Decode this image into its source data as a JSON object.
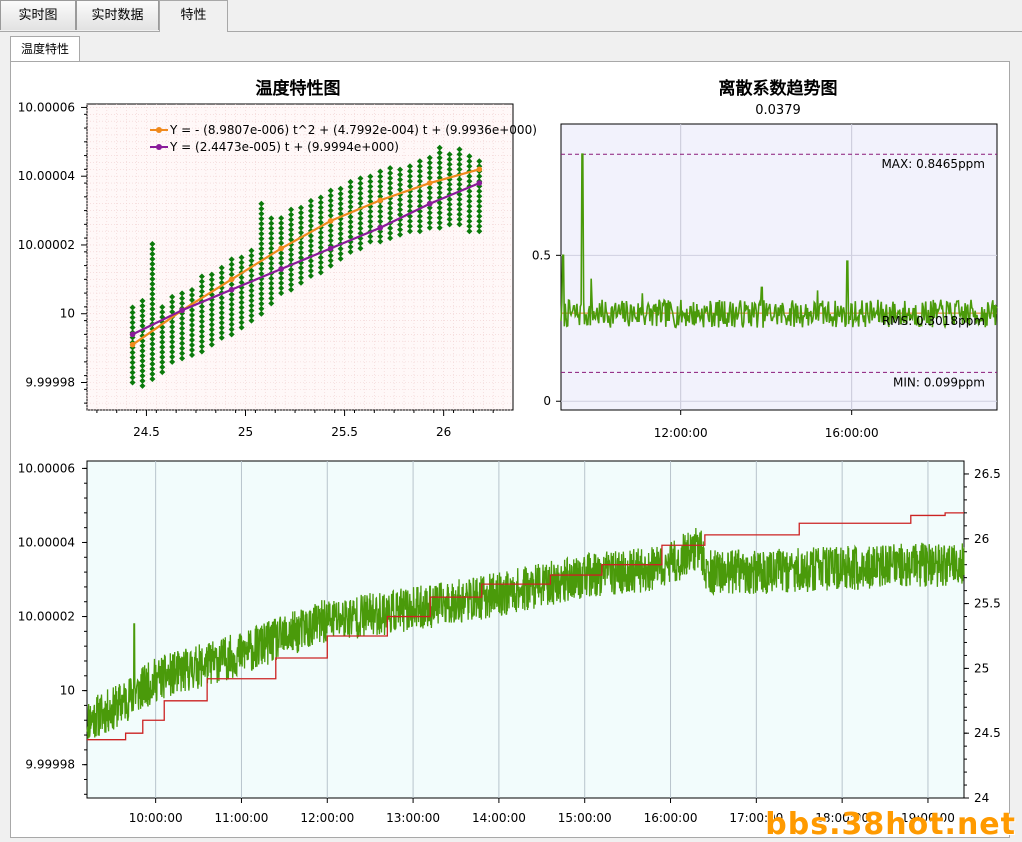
{
  "tabs": [
    {
      "label": "实时图",
      "active": false
    },
    {
      "label": "实时数据",
      "active": false
    },
    {
      "label": "特性",
      "active": true
    }
  ],
  "subtab": {
    "label": "温度特性"
  },
  "watermark": "bbs.38hot.net",
  "chart_data": [
    {
      "type": "scatter",
      "title": "温度特性图",
      "xlim": [
        24.2,
        26.35
      ],
      "ylim": [
        9.999972,
        10.000061
      ],
      "x_ticks": [
        "24.5",
        "25",
        "25.5",
        "26"
      ],
      "x_tick_values": [
        24.5,
        25,
        25.5,
        26
      ],
      "y_ticks": [
        "10.00006",
        "10.00004",
        "10.00002",
        "10",
        "9.99998"
      ],
      "y_tick_values": [
        10.00006,
        10.00004,
        10.00002,
        10.0,
        9.99998
      ],
      "grid": true,
      "legend_position": "top-right",
      "scatter_color": "#0b7a0b",
      "scatter_columns": [
        {
          "x": 24.43,
          "y_min": 9.99998,
          "y_max": 10.000003
        },
        {
          "x": 24.48,
          "y_min": 9.999979,
          "y_max": 10.000005
        },
        {
          "x": 24.53,
          "y_min": 9.999981,
          "y_max": 10.000021
        },
        {
          "x": 24.58,
          "y_min": 9.999983,
          "y_max": 10.000003
        },
        {
          "x": 24.63,
          "y_min": 9.999986,
          "y_max": 10.000005
        },
        {
          "x": 24.68,
          "y_min": 9.999987,
          "y_max": 10.000007
        },
        {
          "x": 24.73,
          "y_min": 9.999988,
          "y_max": 10.000008
        },
        {
          "x": 24.78,
          "y_min": 9.999989,
          "y_max": 10.000011
        },
        {
          "x": 24.83,
          "y_min": 9.999991,
          "y_max": 10.000012
        },
        {
          "x": 24.88,
          "y_min": 9.999993,
          "y_max": 10.000014
        },
        {
          "x": 24.93,
          "y_min": 9.999994,
          "y_max": 10.000016
        },
        {
          "x": 24.98,
          "y_min": 9.999996,
          "y_max": 10.000017
        },
        {
          "x": 25.03,
          "y_min": 9.999998,
          "y_max": 10.000019
        },
        {
          "x": 25.08,
          "y_min": 10.0,
          "y_max": 10.000032
        },
        {
          "x": 25.13,
          "y_min": 10.000003,
          "y_max": 10.000028
        },
        {
          "x": 25.18,
          "y_min": 10.000006,
          "y_max": 10.000029
        },
        {
          "x": 25.23,
          "y_min": 10.000007,
          "y_max": 10.000031
        },
        {
          "x": 25.28,
          "y_min": 10.000009,
          "y_max": 10.000031
        },
        {
          "x": 25.33,
          "y_min": 10.000011,
          "y_max": 10.000033
        },
        {
          "x": 25.38,
          "y_min": 10.000012,
          "y_max": 10.000034
        },
        {
          "x": 25.43,
          "y_min": 10.000014,
          "y_max": 10.000036
        },
        {
          "x": 25.48,
          "y_min": 10.000016,
          "y_max": 10.000037
        },
        {
          "x": 25.53,
          "y_min": 10.000018,
          "y_max": 10.000039
        },
        {
          "x": 25.58,
          "y_min": 10.000019,
          "y_max": 10.00004
        },
        {
          "x": 25.63,
          "y_min": 10.000021,
          "y_max": 10.000041
        },
        {
          "x": 25.68,
          "y_min": 10.000021,
          "y_max": 10.000042
        },
        {
          "x": 25.73,
          "y_min": 10.000022,
          "y_max": 10.000043
        },
        {
          "x": 25.78,
          "y_min": 10.000023,
          "y_max": 10.000043
        },
        {
          "x": 25.83,
          "y_min": 10.000024,
          "y_max": 10.000044
        },
        {
          "x": 25.88,
          "y_min": 10.000024,
          "y_max": 10.000045
        },
        {
          "x": 25.93,
          "y_min": 10.000025,
          "y_max": 10.000046
        },
        {
          "x": 25.98,
          "y_min": 10.000025,
          "y_max": 10.000049
        },
        {
          "x": 26.03,
          "y_min": 10.000026,
          "y_max": 10.000047
        },
        {
          "x": 26.08,
          "y_min": 10.000026,
          "y_max": 10.000048
        },
        {
          "x": 26.13,
          "y_min": 10.000024,
          "y_max": 10.000046
        },
        {
          "x": 26.18,
          "y_min": 10.000024,
          "y_max": 10.000045
        }
      ],
      "fits": [
        {
          "label": "Y = - (8.9807e-006) t^2 + (4.7992e-004) t + (9.9936e+000)",
          "color": "#f08a1c",
          "kind": "quadratic",
          "x_range": [
            24.43,
            26.18
          ],
          "x_samples": [
            24.43,
            24.68,
            24.93,
            25.18,
            25.43,
            25.68,
            25.93,
            26.18
          ],
          "y_samples": [
            9.999991,
            10.000001,
            10.00001,
            10.000019,
            10.000027,
            10.000033,
            10.000038,
            10.000042
          ]
        },
        {
          "label": "Y = (2.4473e-005) t + (9.9994e+000)",
          "color": "#8a1a9a",
          "kind": "linear",
          "x_range": [
            24.43,
            26.18
          ],
          "x_samples": [
            24.43,
            24.68,
            24.93,
            25.18,
            25.43,
            25.68,
            25.93,
            26.18
          ],
          "y_samples": [
            9.999994,
            10.000001,
            10.000007,
            10.000013,
            10.000019,
            10.000025,
            10.000032,
            10.000038
          ]
        }
      ]
    },
    {
      "type": "line",
      "title": "离散系数趋势图",
      "subtitle": "0.0379",
      "xlim_hours": [
        9.2,
        19.4
      ],
      "ylim": [
        -0.03,
        0.95
      ],
      "x_ticks": [
        "12:00:00",
        "16:00:00"
      ],
      "x_tick_values": [
        12,
        16
      ],
      "y_ticks": [
        "0.5",
        "0"
      ],
      "y_tick_values": [
        0.5,
        0
      ],
      "series": [
        {
          "color": "#4a9a0a",
          "base_value": 0.3,
          "noise_amplitude": 0.03,
          "spikes": [
            [
              9.25,
              0.5
            ],
            [
              9.7,
              0.8465
            ],
            [
              9.9,
              0.42
            ],
            [
              11.1,
              0.37
            ],
            [
              13.9,
              0.39
            ],
            [
              15.2,
              0.38
            ],
            [
              15.9,
              0.48
            ]
          ]
        }
      ],
      "reference_lines": [
        {
          "label": "MAX: 0.8465ppm",
          "value": 0.8465,
          "color": "#8a1a7a",
          "style": "dashed"
        },
        {
          "label": "RMS: 0.3018ppm",
          "value": 0.3018,
          "color": "#e07a10",
          "style": "solid"
        },
        {
          "label": "MIN: 0.099ppm",
          "value": 0.099,
          "color": "#8a1a7a",
          "style": "dashed"
        }
      ],
      "background": "#f2f2fc"
    },
    {
      "type": "line",
      "xlim_hours": [
        9.2,
        19.42
      ],
      "x_ticks": [
        "10:00:00",
        "11:00:00",
        "12:00:00",
        "13:00:00",
        "14:00:00",
        "15:00:00",
        "16:00:00",
        "17:00:00",
        "18:00:00",
        "19:00:00"
      ],
      "x_tick_values": [
        10,
        11,
        12,
        13,
        14,
        15,
        16,
        17,
        18,
        19
      ],
      "y_left_lim": [
        9.999971,
        10.000062
      ],
      "y_left_ticks": [
        "10.00006",
        "10.00004",
        "10.00002",
        "10",
        "9.99998"
      ],
      "y_left_tick_values": [
        10.00006,
        10.00004,
        10.00002,
        10.0,
        9.99998
      ],
      "y_right_lim": [
        24.0,
        26.6
      ],
      "y_right_ticks": [
        "26.5",
        "26",
        "25.5",
        "25",
        "24.5",
        "24"
      ],
      "y_right_tick_values": [
        26.5,
        26.0,
        25.5,
        25.0,
        24.5,
        24.0
      ],
      "background": "#f2fcfc",
      "grid": "vertical",
      "series": [
        {
          "axis": "left",
          "color": "#4a9a0a",
          "trend_hours": [
            9.2,
            9.5,
            10.0,
            11.0,
            12.0,
            13.0,
            14.0,
            15.0,
            15.9,
            16.35,
            16.4,
            17.0,
            18.0,
            19.0,
            19.42
          ],
          "trend_values": [
            9.999992,
            9.999995,
            10.000003,
            10.00001,
            10.000019,
            10.000022,
            10.000026,
            10.000031,
            10.000033,
            10.000039,
            10.000032,
            10.000032,
            10.000033,
            10.000034,
            10.000034
          ],
          "noise_amplitude": 6e-06
        },
        {
          "axis": "right",
          "color": "#cc2222",
          "step_hours": [
            9.2,
            9.5,
            9.65,
            9.85,
            10.1,
            10.6,
            11.4,
            12.0,
            12.7,
            13.2,
            13.8,
            14.6,
            15.2,
            15.9,
            16.4,
            17.5,
            18.8,
            19.0,
            19.2
          ],
          "step_values": [
            24.45,
            24.45,
            24.5,
            24.6,
            24.75,
            24.92,
            25.08,
            25.25,
            25.4,
            25.55,
            25.65,
            25.72,
            25.8,
            25.95,
            26.03,
            26.12,
            26.18,
            26.18,
            26.2
          ]
        }
      ]
    }
  ]
}
